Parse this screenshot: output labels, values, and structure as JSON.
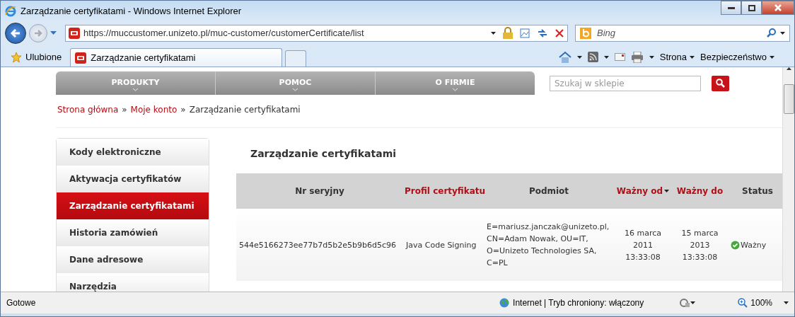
{
  "window": {
    "title": "Zarządzanie certyfikatami - Windows Internet Explorer"
  },
  "address_bar": {
    "url": "https://muccustomer.unizeto.pl/muc-customer/customerCertificate/list"
  },
  "search_box": {
    "placeholder": "Bing"
  },
  "favorites": {
    "label": "Ulubione"
  },
  "tabs": [
    {
      "label": "Zarządzanie certyfikatami",
      "selected": true
    }
  ],
  "command_bar": [
    "Strona",
    "Bezpieczeństwo"
  ],
  "site_nav": [
    "PRODUKTY",
    "POMOC",
    "O FIRMIE"
  ],
  "site_search": {
    "placeholder": "Szukaj w sklepie"
  },
  "breadcrumb": {
    "separator": "»",
    "items": [
      {
        "label": "Strona główna",
        "kind": "link"
      },
      {
        "label": "Moje konto",
        "kind": "link"
      },
      {
        "label": "Zarządzanie certyfikatami",
        "kind": "current"
      }
    ]
  },
  "sidebar": {
    "items": [
      {
        "label": "Kody elektroniczne",
        "selected": false
      },
      {
        "label": "Aktywacja certyfikatów",
        "selected": false
      },
      {
        "label": "Zarządzanie certyfikatami",
        "selected": true
      },
      {
        "label": "Historia zamówień",
        "selected": false
      },
      {
        "label": "Dane adresowe",
        "selected": false
      },
      {
        "label": "Narzędzia",
        "selected": false
      }
    ]
  },
  "heading": "Zarządzanie certyfikatami",
  "table": {
    "columns": [
      {
        "label": "Nr seryjny",
        "sortable": false,
        "sorted": false
      },
      {
        "label": "Profil certyfikatu",
        "sortable": true,
        "sorted": false
      },
      {
        "label": "Podmiot",
        "sortable": false,
        "sorted": false
      },
      {
        "label": "Ważny od",
        "sortable": true,
        "sorted": true
      },
      {
        "label": "Ważny do",
        "sortable": true,
        "sorted": false
      },
      {
        "label": "Status",
        "sortable": false,
        "sorted": false
      }
    ],
    "rows": [
      {
        "cells": [
          "544e5166273ee77b7d5b2e5b9b6d5c96",
          "Java Code Signing",
          "E=mariusz.janczak@unizeto.pl, CN=Adam Nowak, OU=IT, O=Unizeto Technologies SA, C=PL",
          "16 marca 2011 13:33:08",
          "15 marca 2013 13:33:08",
          "Ważny"
        ],
        "valid": true
      }
    ]
  },
  "status_bar": {
    "text": "Gotowe",
    "zone": "Internet | Tryb chroniony: włączony",
    "zoom": "100%"
  }
}
